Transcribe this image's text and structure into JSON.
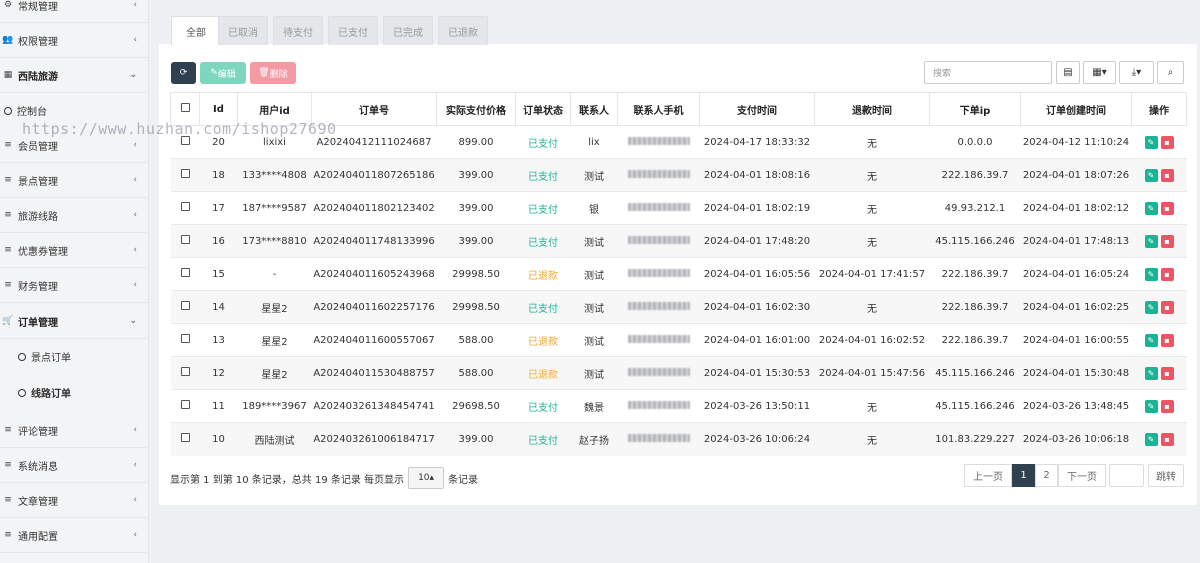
{
  "sidebar": {
    "items": [
      {
        "label": "常规管理",
        "icon": "gears-icon"
      },
      {
        "label": "权限管理",
        "icon": "users-icon"
      },
      {
        "label": "西陆旅游",
        "icon": "grid-icon"
      },
      {
        "label": "控制台",
        "icon": "circle-icon"
      },
      {
        "label": "会员管理",
        "icon": "list-icon"
      },
      {
        "label": "景点管理",
        "icon": "list-icon"
      },
      {
        "label": "旅游线路",
        "icon": "list-icon"
      },
      {
        "label": "优惠券管理",
        "icon": "list-icon"
      },
      {
        "label": "财务管理",
        "icon": "list-icon"
      },
      {
        "label": "订单管理",
        "icon": "cart-icon"
      },
      {
        "label": "景点订单",
        "icon": "circle-icon"
      },
      {
        "label": "线路订单",
        "icon": "circle-icon"
      },
      {
        "label": "评论管理",
        "icon": "list-icon"
      },
      {
        "label": "系统消息",
        "icon": "list-icon"
      },
      {
        "label": "文章管理",
        "icon": "list-icon"
      },
      {
        "label": "通用配置",
        "icon": "list-icon"
      }
    ]
  },
  "watermark": "https://www.huzhan.com/ishop27690",
  "tabs": [
    "全部",
    "已取消",
    "待支付",
    "已支付",
    "已完成",
    "已退款"
  ],
  "toolbar": {
    "refresh_icon": "refresh-icon",
    "edit_label": "编辑",
    "delete_label": "删除",
    "search_placeholder": "搜索"
  },
  "colors": {
    "dark": "#2f4050",
    "edit": "#1ab394",
    "delete": "#ed5565",
    "paid": "#1ab394",
    "refunded": "#f0a830"
  },
  "table": {
    "headers": [
      "Id",
      "用户id",
      "订单号",
      "实际支付价格",
      "订单状态",
      "联系人",
      "联系人手机",
      "支付时间",
      "退款时间",
      "下单ip",
      "订单创建时间",
      "操作"
    ],
    "rows": [
      {
        "id": "20",
        "user": "lixixi",
        "order": "A202404121110246​87",
        "price": "899.00",
        "status": "已支付",
        "contact": "lix",
        "pay_time": "2024-04-17 18:33:32",
        "refund_time": "无",
        "ip": "0.0.0.0",
        "created": "2024-04-12 11:10:24"
      },
      {
        "id": "18",
        "user": "133****4808",
        "order": "A202404011807265186",
        "price": "399.00",
        "status": "已支付",
        "contact": "测试",
        "pay_time": "2024-04-01 18:08:16",
        "refund_time": "无",
        "ip": "222.186.39.7",
        "created": "2024-04-01 18:07:26"
      },
      {
        "id": "17",
        "user": "187****9587",
        "order": "A202404011802123402",
        "price": "399.00",
        "status": "已支付",
        "contact": "银",
        "pay_time": "2024-04-01 18:02:19",
        "refund_time": "无",
        "ip": "49.93.212.1",
        "created": "2024-04-01 18:02:12"
      },
      {
        "id": "16",
        "user": "173****8810",
        "order": "A202404011748133996",
        "price": "399.00",
        "status": "已支付",
        "contact": "测试",
        "pay_time": "2024-04-01 17:48:20",
        "refund_time": "无",
        "ip": "45.115.166.246",
        "created": "2024-04-01 17:48:13"
      },
      {
        "id": "15",
        "user": "-",
        "order": "A202404011605243968",
        "price": "29998.50",
        "status": "已退款",
        "contact": "测试",
        "pay_time": "2024-04-01 16:05:56",
        "refund_time": "2024-04-01 17:41:57",
        "ip": "222.186.39.7",
        "created": "2024-04-01 16:05:24"
      },
      {
        "id": "14",
        "user": "星星2",
        "order": "A202404011602257176",
        "price": "29998.50",
        "status": "已支付",
        "contact": "测试",
        "pay_time": "2024-04-01 16:02:30",
        "refund_time": "无",
        "ip": "222.186.39.7",
        "created": "2024-04-01 16:02:25"
      },
      {
        "id": "13",
        "user": "星星2",
        "order": "A202404011600557067",
        "price": "588.00",
        "status": "已退款",
        "contact": "测试",
        "pay_time": "2024-04-01 16:01:00",
        "refund_time": "2024-04-01 16:02:52",
        "ip": "222.186.39.7",
        "created": "2024-04-01 16:00:55"
      },
      {
        "id": "12",
        "user": "星星2",
        "order": "A202404011530488757",
        "price": "588.00",
        "status": "已退款",
        "contact": "测试",
        "pay_time": "2024-04-01 15:30:53",
        "refund_time": "2024-04-01 15:47:56",
        "ip": "45.115.166.246",
        "created": "2024-04-01 15:30:48"
      },
      {
        "id": "11",
        "user": "189****3967",
        "order": "A202403261348454741",
        "price": "29698.50",
        "status": "已支付",
        "contact": "魏景",
        "pay_time": "2024-03-26 13:50:11",
        "refund_time": "无",
        "ip": "45.115.166.246",
        "created": "2024-03-26 13:48:45"
      },
      {
        "id": "10",
        "user": "西陆测试",
        "order": "A202403261006184717",
        "price": "399.00",
        "status": "已支付",
        "contact": "赵子扬",
        "pay_time": "2024-03-26 10:06:24",
        "refund_time": "无",
        "ip": "101.83.229.227",
        "created": "2024-03-26 10:06:18"
      }
    ]
  },
  "footer": {
    "info_prefix": "显示第 1 到第 10 条记录，总共 19 条记录 每页显示",
    "page_size": "10",
    "info_suffix": "条记录",
    "prev": "上一页",
    "pages": [
      "1",
      "2"
    ],
    "next": "下一页",
    "jump": "跳转"
  }
}
